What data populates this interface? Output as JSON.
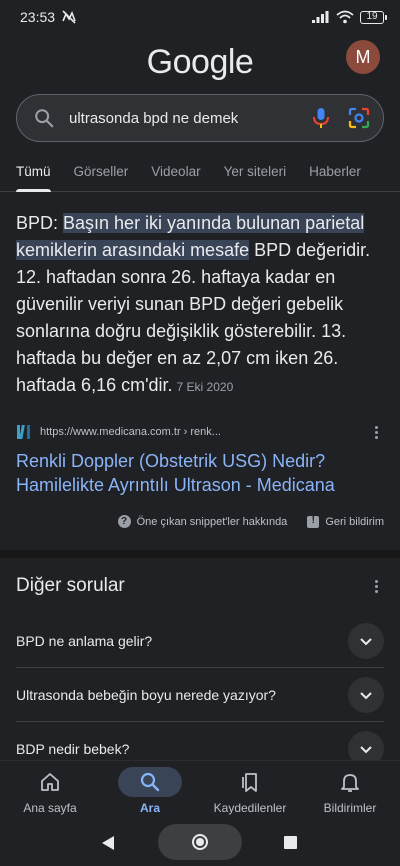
{
  "status_bar": {
    "time": "23:53",
    "battery": "19"
  },
  "header": {
    "logo": "Google",
    "avatar_letter": "M"
  },
  "search": {
    "query": "ultrasonda bpd ne demek"
  },
  "tabs": [
    {
      "label": "Tümü",
      "active": true
    },
    {
      "label": "Görseller"
    },
    {
      "label": "Videolar"
    },
    {
      "label": "Yer siteleri"
    },
    {
      "label": "Haberler"
    }
  ],
  "snippet": {
    "prefix": "BPD: ",
    "highlight": "Başın her iki yanında bulunan parietal kemiklerin arasındaki mesafe",
    "body": " BPD değeridir. 12. haftadan sonra 26. haftaya kadar en güvenilir veriyi sunan BPD değeri gebelik sonlarına doğru değişiklik gösterebilir. 13. haftada bu değer en az 2,07 cm iken 26. haftada 6,16 cm'dir.",
    "date": "7 Eki 2020"
  },
  "source": {
    "url": "https://www.medicana.com.tr › renk...",
    "title": "Renkli Doppler (Obstetrik USG) Nedir? Hamilelikte Ayrıntılı Ultrason - Medicana"
  },
  "feedback": {
    "about": "Öne çıkan snippet'ler hakkında",
    "report": "Geri bildirim"
  },
  "other_questions": {
    "title": "Diğer sorular",
    "items": [
      "BPD ne anlama gelir?",
      "Ultrasonda bebeğin boyu nerede yazıyor?",
      "BDP nedir bebek?"
    ]
  },
  "bottom_nav": [
    {
      "label": "Ana sayfa",
      "icon": "home-icon"
    },
    {
      "label": "Ara",
      "icon": "search-icon",
      "active": true
    },
    {
      "label": "Kaydedilenler",
      "icon": "bookmarks-icon"
    },
    {
      "label": "Bildirimler",
      "icon": "bell-icon"
    }
  ],
  "colors": {
    "link": "#8ab4f8",
    "highlight": "#394457",
    "background": "#202124"
  }
}
